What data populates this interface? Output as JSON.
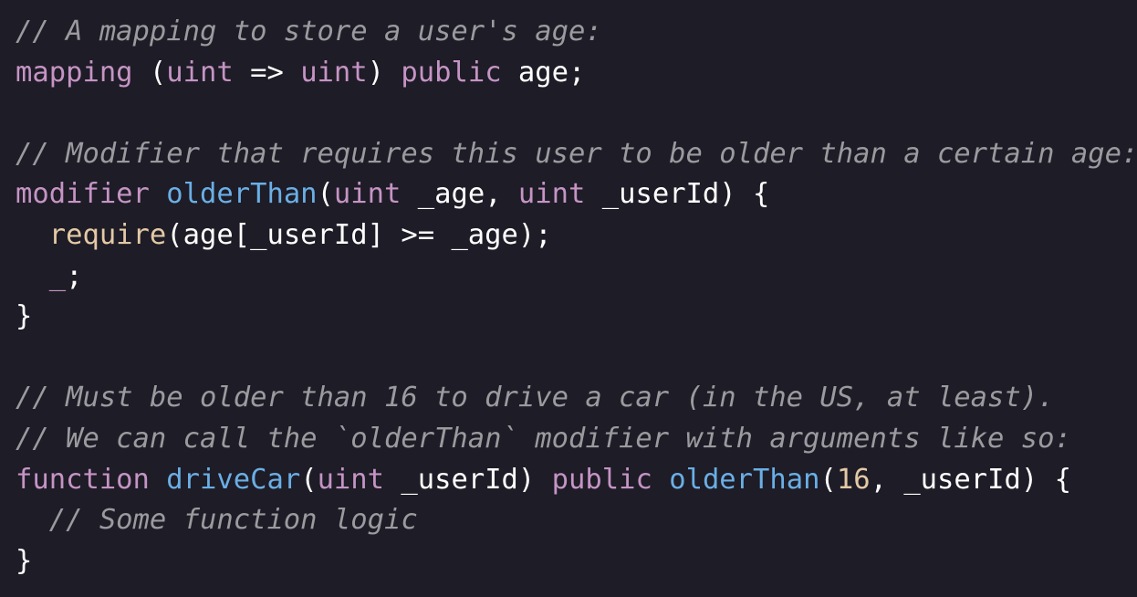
{
  "theme": {
    "background": "#1e1c26",
    "comment_color": "#9b9a9f",
    "keyword_color": "#c594c5",
    "function_color": "#6aafe6",
    "builtin_color": "#e4c9a6",
    "text_color": "#ffffff"
  },
  "code": {
    "line1": {
      "comment": "// A mapping to store a user's age:"
    },
    "line2": {
      "kw_mapping": "mapping",
      "paren_open": " (",
      "type_uint1": "uint",
      "arrow": " => ",
      "type_uint2": "uint",
      "paren_close": ") ",
      "kw_public": "public",
      "rest": " age;"
    },
    "line3": {},
    "line4": {
      "comment": "// Modifier that requires this user to be older than a certain age:"
    },
    "line5": {
      "kw_modifier": "modifier",
      "space": " ",
      "fn_name": "olderThan",
      "paren_open": "(",
      "type_uint1": "uint",
      "arg1": " _age, ",
      "type_uint2": "uint",
      "arg2": " _userId) {"
    },
    "line6": {
      "indent": "  ",
      "builtin_require": "require",
      "rest": "(age[_userId] >= _age);"
    },
    "line7": {
      "indent": "  ",
      "placeholder": "_",
      "semi": ";"
    },
    "line8": {
      "brace": "}"
    },
    "line9": {},
    "line10": {
      "comment": "// Must be older than 16 to drive a car (in the US, at least)."
    },
    "line11": {
      "comment": "// We can call the `olderThan` modifier with arguments like so:"
    },
    "line12": {
      "kw_function": "function",
      "space1": " ",
      "fn_name": "driveCar",
      "paren_open": "(",
      "type_uint": "uint",
      "arg": " _userId) ",
      "kw_public": "public",
      "space2": " ",
      "modifier_call": "olderThan",
      "paren_open2": "(",
      "number": "16",
      "rest": ", _userId) {"
    },
    "line13": {
      "indent": "  ",
      "comment": "// Some function logic"
    },
    "line14": {
      "brace": "}"
    }
  }
}
